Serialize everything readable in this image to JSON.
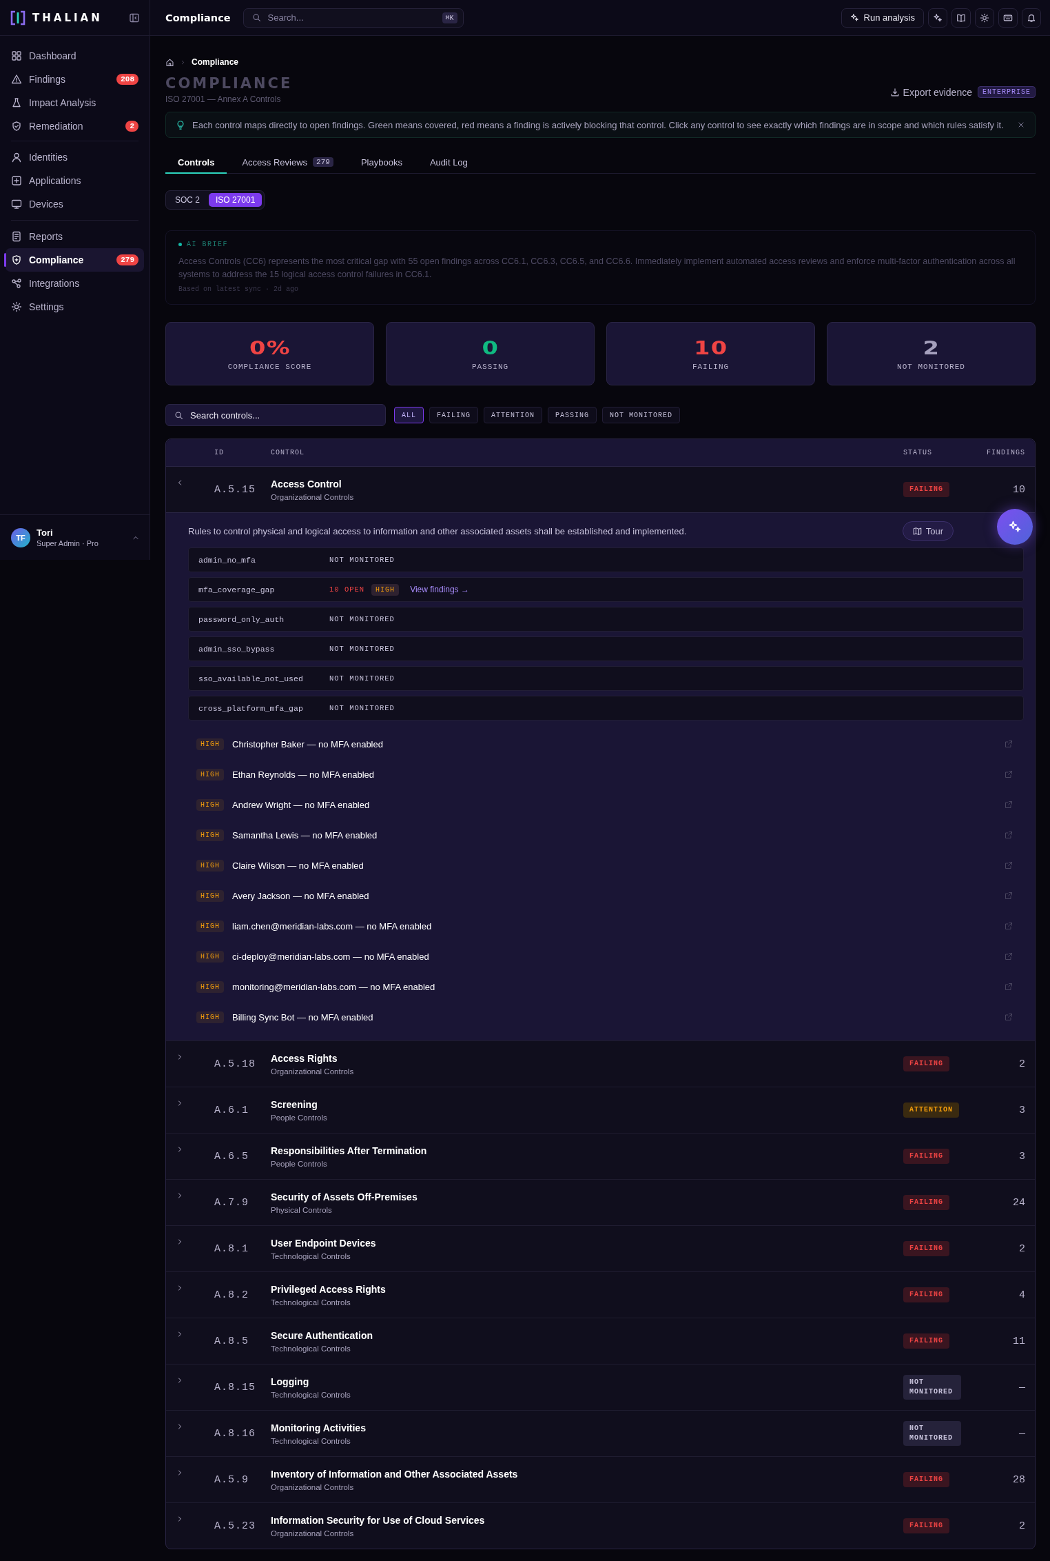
{
  "sidebar": {
    "brand": "THALIAN",
    "sections": [
      {
        "items": [
          {
            "label": "Dashboard",
            "selected": false
          },
          {
            "label": "Findings",
            "badge": "208",
            "selected": false
          },
          {
            "label": "Impact Analysis",
            "selected": false
          },
          {
            "label": "Remediation",
            "badge": "2",
            "selected": false
          }
        ]
      },
      {
        "items": [
          {
            "label": "Identities",
            "selected": false
          },
          {
            "label": "Applications",
            "selected": false
          },
          {
            "label": "Devices",
            "selected": false
          }
        ]
      },
      {
        "items": [
          {
            "label": "Reports",
            "selected": false
          },
          {
            "label": "Compliance",
            "badge": "279",
            "selected": true
          },
          {
            "label": "Integrations",
            "selected": false
          },
          {
            "label": "Settings",
            "selected": false
          }
        ]
      }
    ],
    "user": {
      "initials": "TF",
      "name": "Tori",
      "role": "Super Admin · Pro"
    }
  },
  "topbar": {
    "title": "Compliance",
    "search_placeholder": "Search...",
    "shortcut": "⌘K",
    "run_button": "Run analysis"
  },
  "breadcrumb": [
    "Compliance"
  ],
  "header": {
    "title": "COMPLIANCE",
    "subtitle": "ISO 27001 — Annex A Controls",
    "export_button": "Export evidence",
    "export_badge": "ENTERPRISE"
  },
  "banner": {
    "text": "Each control maps directly to open findings. Green means covered, red means a finding is actively blocking that control. Click any control to see exactly which findings are in scope and which rules satisfy it."
  },
  "tabs": [
    {
      "label": "Controls",
      "selected": true
    },
    {
      "label": "Access Reviews",
      "count": "279",
      "selected": false
    },
    {
      "label": "Playbooks",
      "selected": false
    },
    {
      "label": "Audit Log",
      "selected": false
    }
  ],
  "frameworks": [
    {
      "label": "SOC 2",
      "selected": false
    },
    {
      "label": "ISO 27001",
      "selected": true
    }
  ],
  "ai_brief": {
    "label": "AI BRIEF",
    "text": "Access Controls (CC6) represents the most critical gap with 55 open findings across CC6.1, CC6.3, CC6.5, and CC6.6. Immediately implement automated access reviews and enforce multi-factor authentication across all systems to address the 15 logical access control failures in CC6.1.",
    "meta": "Based on latest sync · 2d ago"
  },
  "stats": [
    {
      "value": "0%",
      "label": "COMPLIANCE SCORE",
      "color": "#ef4444"
    },
    {
      "value": "0",
      "label": "PASSING",
      "color": "#10b981"
    },
    {
      "value": "10",
      "label": "FAILING",
      "color": "#ef4444"
    },
    {
      "value": "2",
      "label": "NOT MONITORED",
      "color": "#a5a0bd"
    }
  ],
  "filters": {
    "search_placeholder": "Search controls...",
    "chips": [
      {
        "label": "ALL",
        "selected": true
      },
      {
        "label": "FAILING",
        "selected": false
      },
      {
        "label": "ATTENTION",
        "selected": false
      },
      {
        "label": "PASSING",
        "selected": false
      },
      {
        "label": "NOT MONITORED",
        "selected": false
      }
    ]
  },
  "table": {
    "columns": [
      "ID",
      "CONTROL",
      "STATUS",
      "FINDINGS"
    ],
    "rows": [
      {
        "id": "A.5.15",
        "name": "Access Control",
        "category": "Organizational Controls",
        "kind": "failing",
        "status_label": "FAILING",
        "findings": "10",
        "expanded": true,
        "description": "Rules to control physical and logical access to information and other associated assets shall be established and implemented.",
        "rules": [
          {
            "name": "admin_no_mfa",
            "kind": "unmonitored",
            "status_label": "NOT MONITORED"
          },
          {
            "name": "mfa_coverage_gap",
            "kind": "open",
            "open_label": "10 OPEN",
            "severity": "HIGH",
            "link": "View findings →"
          },
          {
            "name": "password_only_auth",
            "kind": "unmonitored",
            "status_label": "NOT MONITORED"
          },
          {
            "name": "admin_sso_bypass",
            "kind": "unmonitored",
            "status_label": "NOT MONITORED"
          },
          {
            "name": "sso_available_not_used",
            "kind": "unmonitored",
            "status_label": "NOT MONITORED"
          },
          {
            "name": "cross_platform_mfa_gap",
            "kind": "unmonitored",
            "status_label": "NOT MONITORED"
          }
        ],
        "finding_items": [
          {
            "severity": "HIGH",
            "text": "Christopher Baker — no MFA enabled"
          },
          {
            "severity": "HIGH",
            "text": "Ethan Reynolds — no MFA enabled"
          },
          {
            "severity": "HIGH",
            "text": "Andrew Wright — no MFA enabled"
          },
          {
            "severity": "HIGH",
            "text": "Samantha Lewis — no MFA enabled"
          },
          {
            "severity": "HIGH",
            "text": "Claire Wilson — no MFA enabled"
          },
          {
            "severity": "HIGH",
            "text": "Avery Jackson — no MFA enabled"
          },
          {
            "severity": "HIGH",
            "text": "liam.chen@meridian-labs.com — no MFA enabled"
          },
          {
            "severity": "HIGH",
            "text": "ci-deploy@meridian-labs.com — no MFA enabled"
          },
          {
            "severity": "HIGH",
            "text": "monitoring@meridian-labs.com — no MFA enabled"
          },
          {
            "severity": "HIGH",
            "text": "Billing Sync Bot — no MFA enabled"
          }
        ]
      },
      {
        "id": "A.5.18",
        "name": "Access Rights",
        "category": "Organizational Controls",
        "kind": "failing",
        "status_label": "FAILING",
        "findings": "2",
        "expanded": false
      },
      {
        "id": "A.6.1",
        "name": "Screening",
        "category": "People Controls",
        "kind": "attention",
        "status_label": "ATTENTION",
        "findings": "3",
        "expanded": false
      },
      {
        "id": "A.6.5",
        "name": "Responsibilities After Termination",
        "category": "People Controls",
        "kind": "failing",
        "status_label": "FAILING",
        "findings": "3",
        "expanded": false
      },
      {
        "id": "A.7.9",
        "name": "Security of Assets Off-Premises",
        "category": "Physical Controls",
        "kind": "failing",
        "status_label": "FAILING",
        "findings": "24",
        "expanded": false
      },
      {
        "id": "A.8.1",
        "name": "User Endpoint Devices",
        "category": "Technological Controls",
        "kind": "failing",
        "status_label": "FAILING",
        "findings": "2",
        "expanded": false
      },
      {
        "id": "A.8.2",
        "name": "Privileged Access Rights",
        "category": "Technological Controls",
        "kind": "failing",
        "status_label": "FAILING",
        "findings": "4",
        "expanded": false
      },
      {
        "id": "A.8.5",
        "name": "Secure Authentication",
        "category": "Technological Controls",
        "kind": "failing",
        "status_label": "FAILING",
        "findings": "11",
        "expanded": false
      },
      {
        "id": "A.8.15",
        "name": "Logging",
        "category": "Technological Controls",
        "kind": "not_monitored",
        "status_label": "NOT MONITORED",
        "findings": "—",
        "expanded": false
      },
      {
        "id": "A.8.16",
        "name": "Monitoring Activities",
        "category": "Technological Controls",
        "kind": "not_monitored",
        "status_label": "NOT MONITORED",
        "findings": "—",
        "expanded": false
      },
      {
        "id": "A.5.9",
        "name": "Inventory of Information and Other Associated Assets",
        "category": "Organizational Controls",
        "kind": "failing",
        "status_label": "FAILING",
        "findings": "28",
        "expanded": false
      },
      {
        "id": "A.5.23",
        "name": "Information Security for Use of Cloud Services",
        "category": "Organizational Controls",
        "kind": "failing",
        "status_label": "FAILING",
        "findings": "2",
        "expanded": false
      }
    ]
  },
  "tour_button": "Tour"
}
